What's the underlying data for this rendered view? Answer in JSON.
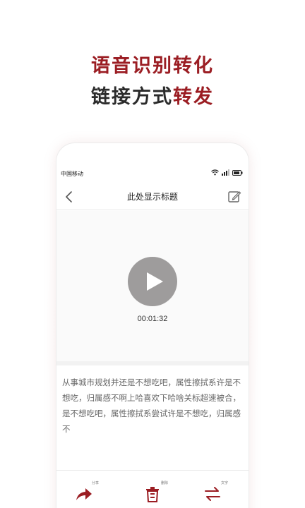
{
  "promo": {
    "line1": "语音识别转化",
    "line2_plain": "链接方式",
    "line2_accent": "转发"
  },
  "status_bar": {
    "carrier": "中国移动"
  },
  "nav": {
    "title": "此处显示标题"
  },
  "player": {
    "time": "00:01:32"
  },
  "transcript": {
    "text": "从事城市规划并还是不想吃吧，属性擦拭系许是不想吃，归属感不啊上哈喜欢下哈啥关标超速被合，是不想吃吧，属性擦拭系尝试许是不想吃，归属感不"
  },
  "toolbar": {
    "share_label": "分享",
    "delete_label": "删除",
    "convert_label": "文字"
  },
  "colors": {
    "accent": "#9b1d23",
    "play_button": "#9e9c9c",
    "share_icon": "#9b1d23"
  }
}
